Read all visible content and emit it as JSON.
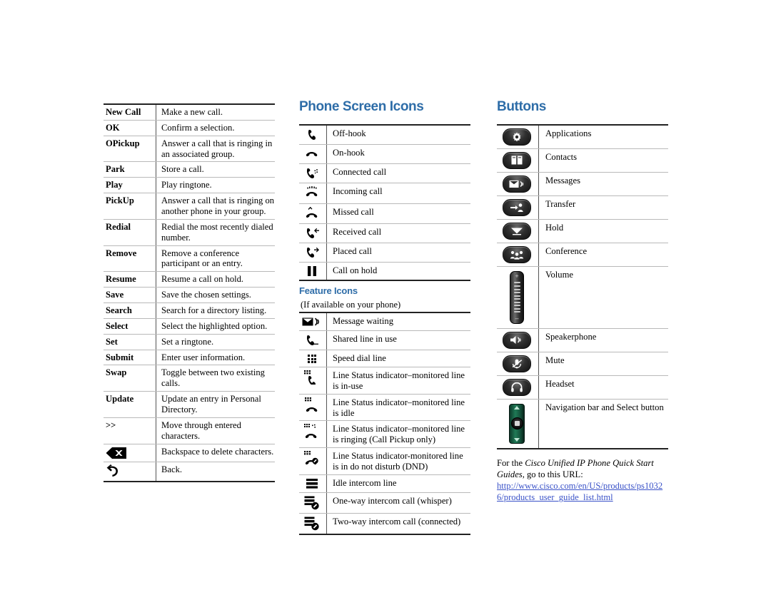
{
  "softkeys": {
    "rows": [
      {
        "key": "New Call",
        "desc": "Make a new call."
      },
      {
        "key": "OK",
        "desc": "Confirm a selection."
      },
      {
        "key": "OPickup",
        "desc": "Answer a call that is ringing in an associated group."
      },
      {
        "key": "Park",
        "desc": "Store a call."
      },
      {
        "key": "Play",
        "desc": "Play ringtone."
      },
      {
        "key": "PickUp",
        "desc": "Answer a call that is ringing on another phone in your group."
      },
      {
        "key": "Redial",
        "desc": "Redial the most recently dialed number."
      },
      {
        "key": "Remove",
        "desc": "Remove a conference participant or an entry."
      },
      {
        "key": "Resume",
        "desc": "Resume a call on hold."
      },
      {
        "key": "Save",
        "desc": "Save the chosen settings."
      },
      {
        "key": "Search",
        "desc": "Search for a directory listing."
      },
      {
        "key": "Select",
        "desc": "Select the highlighted option."
      },
      {
        "key": "Set",
        "desc": "Set a ringtone."
      },
      {
        "key": "Submit",
        "desc": "Enter user information."
      },
      {
        "key": "Swap",
        "desc": "Toggle between two existing calls."
      },
      {
        "key": "Update",
        "desc": "Update an entry in Personal Directory."
      },
      {
        "key": ">>",
        "desc": "Move through entered characters."
      },
      {
        "key": "",
        "icon": "backspace-icon",
        "desc": "Backspace to delete characters."
      },
      {
        "key": "",
        "icon": "back-arrow-icon",
        "desc": "Back."
      }
    ]
  },
  "phone_screen_icons": {
    "heading": "Phone Screen Icons",
    "rows": [
      {
        "icon": "off-hook-icon",
        "desc": "Off-hook"
      },
      {
        "icon": "on-hook-icon",
        "desc": "On-hook"
      },
      {
        "icon": "connected-call-icon",
        "desc": "Connected call"
      },
      {
        "icon": "incoming-call-icon",
        "desc": "Incoming call"
      },
      {
        "icon": "missed-call-icon",
        "desc": "Missed call"
      },
      {
        "icon": "received-call-icon",
        "desc": "Received call"
      },
      {
        "icon": "placed-call-icon",
        "desc": "Placed call"
      },
      {
        "icon": "call-on-hold-icon",
        "desc": "Call on hold"
      }
    ]
  },
  "feature_icons": {
    "heading": "Feature Icons",
    "note": "(If available on your phone)",
    "rows": [
      {
        "icon": "message-waiting-icon",
        "desc": "Message waiting"
      },
      {
        "icon": "shared-line-in-use-icon",
        "desc": "Shared line in use"
      },
      {
        "icon": "speed-dial-line-icon",
        "desc": "Speed dial line"
      },
      {
        "icon": "line-status-in-use-icon",
        "desc": "Line Status indicator–monitored line is in-use"
      },
      {
        "icon": "line-status-idle-icon",
        "desc": "Line Status indicator–monitored line is idle"
      },
      {
        "icon": "line-status-ringing-icon",
        "desc": "Line Status indicator–monitored line is ringing (Call Pickup only)"
      },
      {
        "icon": "line-status-dnd-icon",
        "desc": "Line Status indicator-monitored line is in do not disturb (DND)"
      },
      {
        "icon": "idle-intercom-icon",
        "desc": "Idle intercom line"
      },
      {
        "icon": "one-way-intercom-icon",
        "desc": "One-way intercom call (whisper)"
      },
      {
        "icon": "two-way-intercom-icon",
        "desc": "Two-way intercom call (connected)"
      }
    ]
  },
  "buttons": {
    "heading": "Buttons",
    "rows": [
      {
        "icon": "applications-button-icon",
        "desc": "Applications"
      },
      {
        "icon": "contacts-button-icon",
        "desc": "Contacts"
      },
      {
        "icon": "messages-button-icon",
        "desc": "Messages"
      },
      {
        "icon": "transfer-button-icon",
        "desc": "Transfer"
      },
      {
        "icon": "hold-button-icon",
        "desc": "Hold"
      },
      {
        "icon": "conference-button-icon",
        "desc": "Conference"
      },
      {
        "icon": "volume-rocker-icon",
        "desc": "Volume"
      },
      {
        "icon": "speakerphone-button-icon",
        "desc": "Speakerphone"
      },
      {
        "icon": "mute-button-icon",
        "desc": "Mute"
      },
      {
        "icon": "headset-button-icon",
        "desc": "Headset"
      },
      {
        "icon": "navigation-pad-icon",
        "desc": "Navigation bar and Select button"
      }
    ]
  },
  "tail": {
    "line1_pre": "For the ",
    "line1_italic": "Cisco Unified IP Phone Quick Start Guides",
    "line1_post": ", go to this URL:",
    "url": "http://www.cisco.com/en/US/products/ps10326/products_user_guide_list.html"
  },
  "colors": {
    "heading_blue": "#2e6da8",
    "link_blue": "#3a52c8",
    "nav_green": "#1f7a56",
    "rule_dark": "#222222",
    "rule_light": "#b9b9b9"
  }
}
